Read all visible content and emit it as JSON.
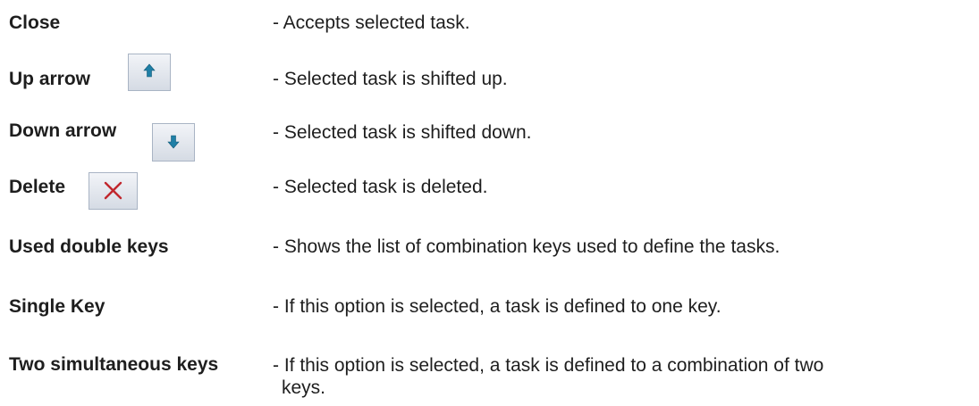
{
  "items": [
    {
      "term": "Close",
      "desc": "- Accepts selected task.",
      "icon": null
    },
    {
      "term": "Up arrow",
      "desc": "- Selected task is shifted up.",
      "icon": "up-arrow-icon"
    },
    {
      "term": "Down arrow",
      "desc": "- Selected task is shifted down.",
      "icon": "down-arrow-icon"
    },
    {
      "term": "Delete",
      "desc": "- Selected task is deleted.",
      "icon": "delete-x-icon"
    },
    {
      "term": "Used double keys",
      "desc": "- Shows the list of combination keys used to define the tasks.",
      "icon": null
    },
    {
      "term": "Single Key",
      "desc": "- If this option is selected, a task is defined to one key.",
      "icon": null
    },
    {
      "term": "Two simultaneous keys",
      "desc": "- If this option is selected, a task is defined to a combination of two",
      "desc_cont": "keys.",
      "icon": null
    }
  ],
  "colors": {
    "text": "#1e1e1e",
    "arrow": "#1f7fa6",
    "delete": "#c1272d"
  }
}
